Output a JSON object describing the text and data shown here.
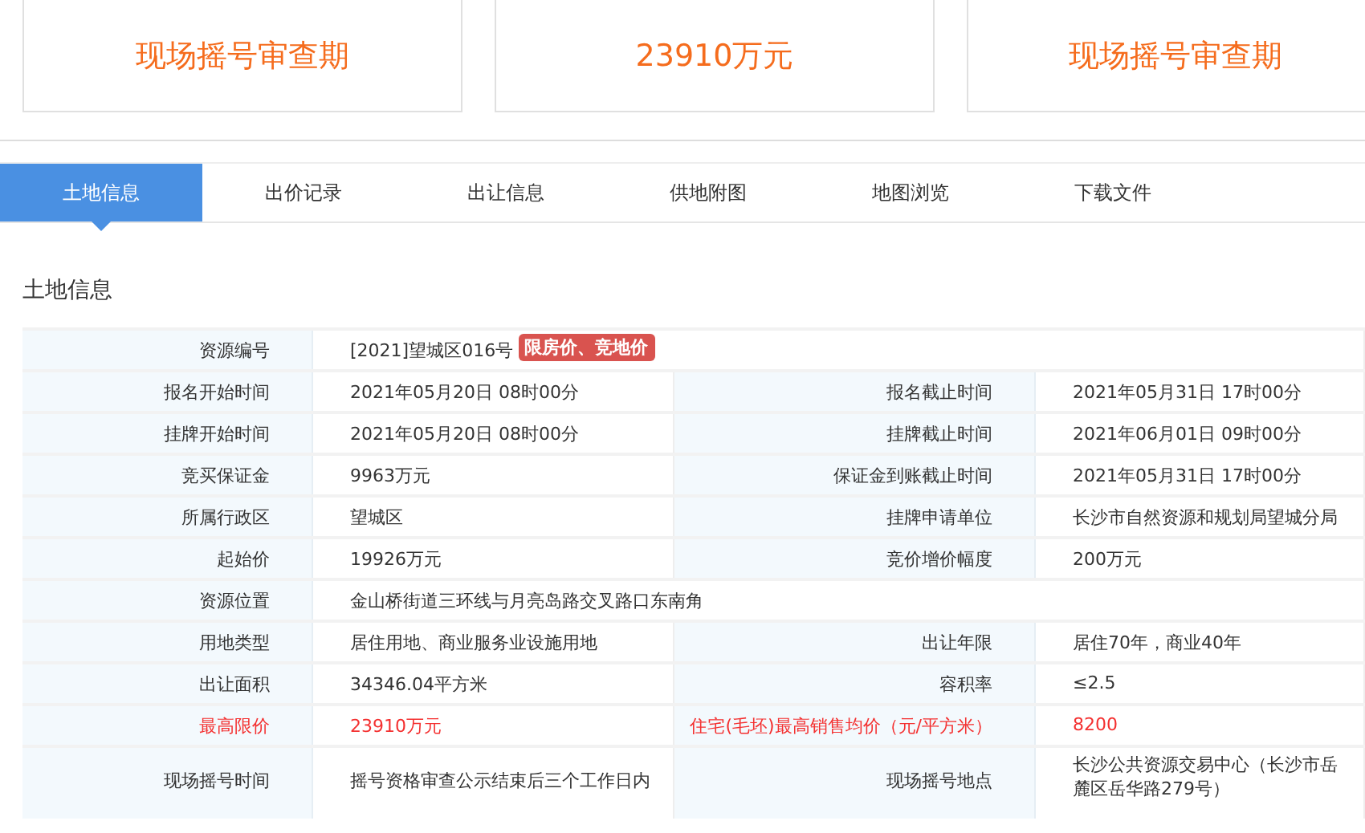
{
  "summary_cards": [
    {
      "value": "现场摇号审查期"
    },
    {
      "value": "23910万元"
    },
    {
      "value": "现场摇号审查期"
    }
  ],
  "tabs": [
    {
      "label": "土地信息",
      "selected": true
    },
    {
      "label": "出价记录",
      "selected": false
    },
    {
      "label": "出让信息",
      "selected": false
    },
    {
      "label": "供地附图",
      "selected": false
    },
    {
      "label": "地图浏览",
      "selected": false
    },
    {
      "label": "下载文件",
      "selected": false
    }
  ],
  "section_title": "土地信息",
  "rows": [
    {
      "kind": "full",
      "label": "资源编号",
      "value": "[2021]望城区016号",
      "tag": "限房价、竞地价"
    },
    {
      "kind": "pair",
      "label": "报名开始时间",
      "value": "2021年05月20日 08时00分",
      "label_2": "报名截止时间",
      "value_2": "2021年05月31日 17时00分"
    },
    {
      "kind": "pair",
      "label": "挂牌开始时间",
      "value": "2021年05月20日 08时00分",
      "label_2": "挂牌截止时间",
      "value_2": "2021年06月01日 09时00分"
    },
    {
      "kind": "pair",
      "label": "竞买保证金",
      "value": "9963万元",
      "label_2": "保证金到账截止时间",
      "value_2": "2021年05月31日 17时00分"
    },
    {
      "kind": "pair",
      "label": "所属行政区",
      "value": "望城区",
      "label_2": "挂牌申请单位",
      "value_2": "长沙市自然资源和规划局望城分局"
    },
    {
      "kind": "pair",
      "label": "起始价",
      "value": "19926万元",
      "label_2": "竞价增价幅度",
      "value_2": "200万元"
    },
    {
      "kind": "full",
      "label": "资源位置",
      "value": "金山桥街道三环线与月亮岛路交叉路口东南角"
    },
    {
      "kind": "pair",
      "label": "用地类型",
      "value": "居住用地、商业服务业设施用地",
      "label_2": "出让年限",
      "value_2": "居住70年，商业40年"
    },
    {
      "kind": "pair",
      "label": "出让面积",
      "value": "34346.04平方米",
      "label_2": "容积率",
      "value_2": "≤2.5"
    },
    {
      "kind": "pair",
      "label": "最高限价",
      "value": "23910万元",
      "label_2": "住宅(毛坯)最高销售均价（元/平方米）",
      "value_2": "8200",
      "highlight": true
    },
    {
      "kind": "pair",
      "label": "现场摇号时间",
      "value": "摇号资格审查公示结束后三个工作日内",
      "label_2": "现场摇号地点",
      "value_2": "长沙公共资源交易中心（长沙市岳麓区岳华路279号）"
    }
  ]
}
